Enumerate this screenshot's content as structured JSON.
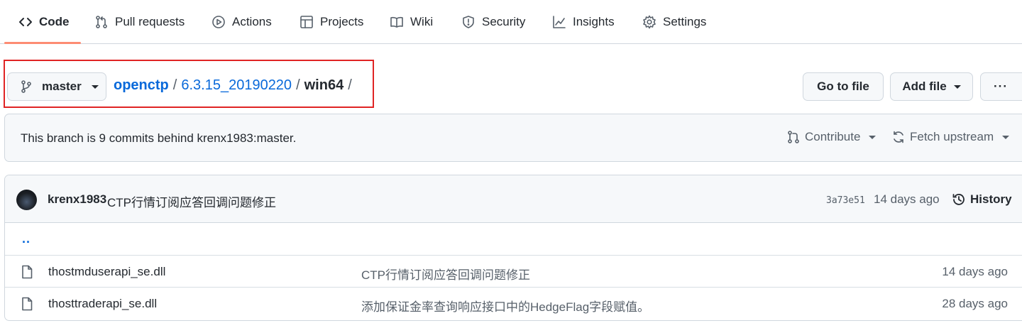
{
  "tabs": [
    {
      "label": "Code",
      "icon": "code-icon",
      "active": true
    },
    {
      "label": "Pull requests",
      "icon": "pull-request-icon"
    },
    {
      "label": "Actions",
      "icon": "play-icon"
    },
    {
      "label": "Projects",
      "icon": "table-icon"
    },
    {
      "label": "Wiki",
      "icon": "book-icon"
    },
    {
      "label": "Security",
      "icon": "shield-icon"
    },
    {
      "label": "Insights",
      "icon": "graph-icon"
    },
    {
      "label": "Settings",
      "icon": "gear-icon"
    }
  ],
  "branch": {
    "name": "master",
    "icon": "git-branch-icon"
  },
  "breadcrumb": {
    "repo": "openctp",
    "folder": "6.3.15_20190220",
    "current": "win64",
    "sep": "/"
  },
  "actions": {
    "go_to_file": "Go to file",
    "add_file": "Add file",
    "more": "···"
  },
  "branch_info": {
    "text": "This branch is 9 commits behind krenx1983:master.",
    "contribute": "Contribute",
    "fetch_upstream": "Fetch upstream"
  },
  "latest_commit": {
    "author": "krenx1983",
    "message": "CTP行情订阅应答回调问题修正",
    "sha": "3a73e51",
    "time": "14 days ago",
    "history_label": "History"
  },
  "parent_link": "..",
  "files": [
    {
      "name": "thostmduserapi_se.dll",
      "message": "CTP行情订阅应答回调问题修正",
      "time": "14 days ago",
      "icon": "file-icon"
    },
    {
      "name": "thosttraderapi_se.dll",
      "message": "添加保证金率查询响应接口中的HedgeFlag字段赋值。",
      "time": "28 days ago",
      "icon": "file-icon"
    }
  ],
  "colors": {
    "accent": "#0969da",
    "tab_underline": "#fd8c73",
    "highlight": "#e02424"
  }
}
